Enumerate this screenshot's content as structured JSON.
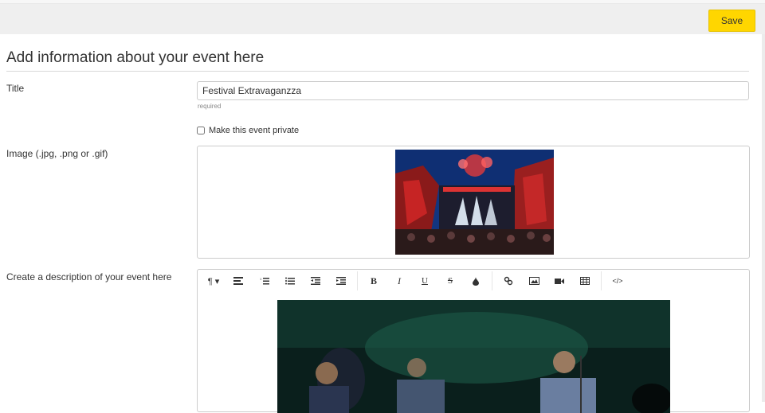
{
  "toolbar": {
    "save_label": "Save"
  },
  "form": {
    "heading": "Add information about your event here",
    "title_label": "Title",
    "title_value": "Festival Extravaganzza",
    "title_help": "required",
    "private_label": "Make this event private",
    "private_checked": false,
    "image_label": "Image (.jpg, .png or .gif)",
    "description_label": "Create a description of your event here"
  },
  "editor": {
    "groups": [
      [
        "paragraph-style-icon",
        "align-icon",
        "ordered-list-icon",
        "unordered-list-icon",
        "outdent-icon",
        "indent-icon"
      ],
      [
        "bold-icon",
        "italic-icon",
        "underline-icon",
        "strikethrough-icon",
        "color-icon"
      ],
      [
        "link-icon",
        "image-icon",
        "video-icon",
        "table-icon"
      ],
      [
        "code-view-icon"
      ]
    ]
  }
}
